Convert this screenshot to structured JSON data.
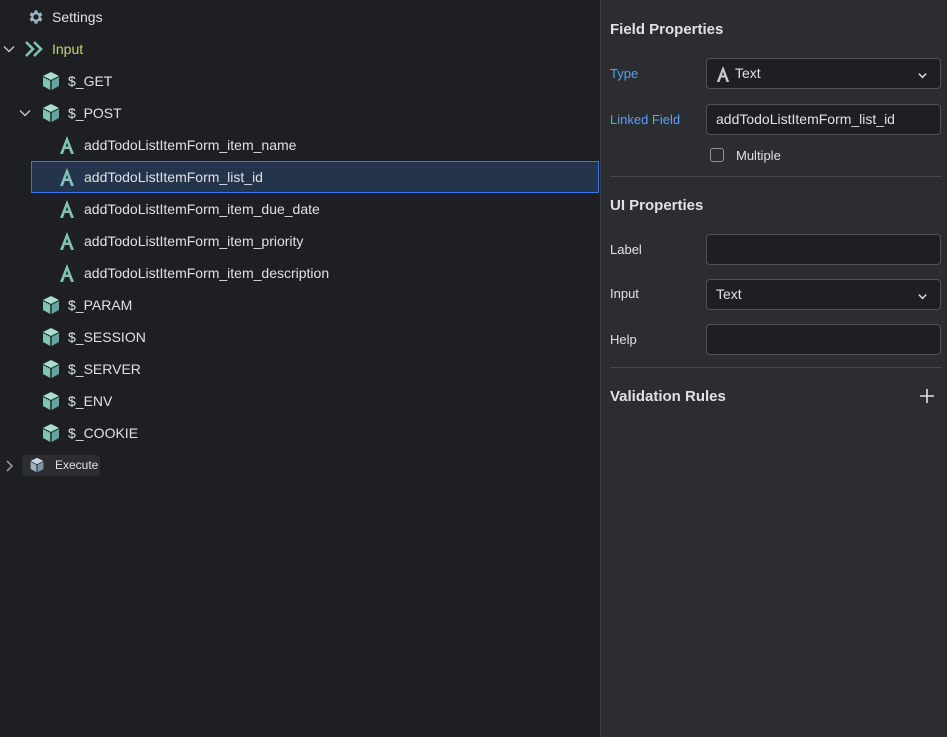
{
  "tree": {
    "settings": {
      "label": "Settings",
      "icon": "gear-icon"
    },
    "input": {
      "label": "Input",
      "icon": "double-chevron-right-icon",
      "expanded": true
    },
    "get": {
      "label": "$_GET",
      "icon": "cube-icon"
    },
    "post": {
      "label": "$_POST",
      "icon": "cube-icon",
      "expanded": true,
      "fields": [
        {
          "label": "addTodoListItemForm_item_name",
          "icon": "text-type-icon"
        },
        {
          "label": "addTodoListItemForm_list_id",
          "icon": "text-type-icon",
          "selected": true
        },
        {
          "label": "addTodoListItemForm_item_due_date",
          "icon": "text-type-icon"
        },
        {
          "label": "addTodoListItemForm_item_priority",
          "icon": "text-type-icon"
        },
        {
          "label": "addTodoListItemForm_item_description",
          "icon": "text-type-icon"
        }
      ]
    },
    "others": [
      {
        "label": "$_PARAM",
        "icon": "cube-icon"
      },
      {
        "label": "$_SESSION",
        "icon": "cube-icon"
      },
      {
        "label": "$_SERVER",
        "icon": "cube-icon"
      },
      {
        "label": "$_ENV",
        "icon": "cube-icon"
      },
      {
        "label": "$_COOKIE",
        "icon": "cube-icon"
      }
    ],
    "execute": {
      "label": "Execute",
      "icon": "cube-icon",
      "expanded": false
    }
  },
  "panel": {
    "field_properties": {
      "title": "Field Properties",
      "type_label": "Type",
      "type_value": "Text",
      "linked_field_label": "Linked Field",
      "linked_field_value": "addTodoListItemForm_list_id",
      "multiple_label": "Multiple",
      "multiple_checked": false
    },
    "ui_properties": {
      "title": "UI Properties",
      "label_label": "Label",
      "label_value": "",
      "input_label": "Input",
      "input_value": "Text",
      "help_label": "Help",
      "help_value": ""
    },
    "validation_rules": {
      "title": "Validation Rules"
    }
  },
  "colors": {
    "accent_blue": "#3574f0",
    "label_blue": "#5aa0f0",
    "input_green": "#c6d17a",
    "icon_teal": "#7fc3b6",
    "selection_bg": "#23344b"
  }
}
